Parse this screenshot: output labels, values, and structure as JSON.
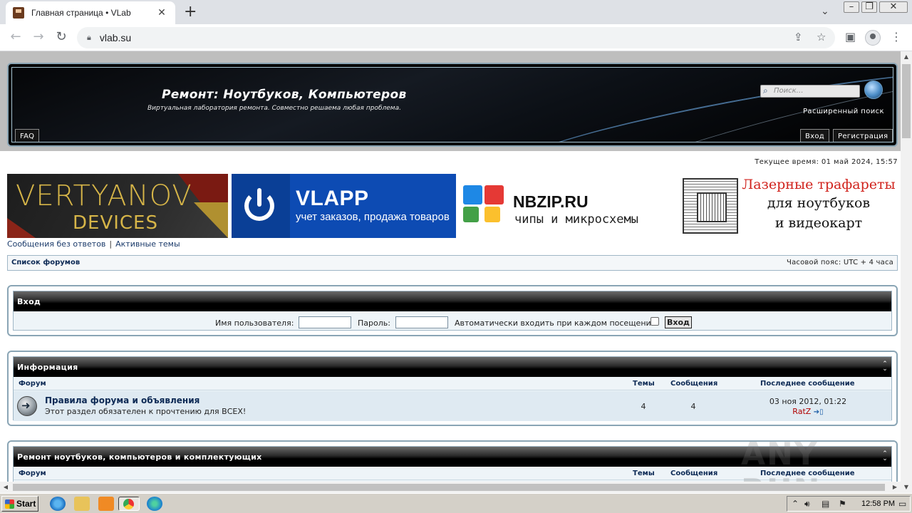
{
  "browser": {
    "tab_title": "Главная страница • VLab",
    "new_tab": "+",
    "url": "vlab.su"
  },
  "header": {
    "site_title": "Ремонт: Ноутбуков, Компьютеров",
    "site_desc": "Виртуальная лаборатория ремонта. Совместно решаема любая проблема.",
    "search_placeholder": "Поиск…",
    "adv_search": "Расширенный поиск",
    "faq": "FAQ",
    "login": "Вход",
    "register": "Регистрация"
  },
  "current_time": "Текущее время: 01 май 2024, 15:57",
  "ads": {
    "ad1": {
      "line1": "VERTYANOV",
      "line2": "DEVICES"
    },
    "ad2": {
      "name": "VLAPP",
      "sub": "учет заказов, продажа товаров"
    },
    "ad3": {
      "name": "NBZIP.RU",
      "sub": "чипы и микросхемы"
    },
    "ad4": {
      "line1": "Лазерные трафареты",
      "line2": "для ноутбуков",
      "line3": "и видеокарт"
    },
    "colors": {
      "vlapp_blue": "#0d4bb3",
      "nbzip_red": "#e53935",
      "nbzip_blue": "#1e88e5",
      "nbzip_green": "#43a047",
      "nbzip_yellow": "#fbc02d",
      "vertyanov_gold": "#d6b548"
    }
  },
  "quicklinks": {
    "unanswered": "Сообщения без ответов",
    "separator": "|",
    "active": "Активные темы"
  },
  "navbar": {
    "forum_index": "Список форумов",
    "timezone": "Часовой пояс: UTC + 4 часа"
  },
  "login_panel": {
    "title": "Вход",
    "username_label": "Имя пользователя:",
    "password_label": "Пароль:",
    "autologin_label": "Автоматически входить при каждом посещении",
    "submit": "Вход"
  },
  "info_panel": {
    "title": "Информация",
    "toggle": "⌃⌄",
    "columns": {
      "forum": "Форум",
      "topics": "Темы",
      "posts": "Сообщения",
      "last": "Последнее сообщение"
    },
    "rows": [
      {
        "name": "Правила форума и объявления",
        "desc": "Этот раздел обязателен к прочтению для ВСЕХ!",
        "topics": "4",
        "posts": "4",
        "last_date": "03 ноя 2012, 01:22",
        "last_author": "RatZ"
      }
    ]
  },
  "repair_panel": {
    "title": "Ремонт ноутбуков, компьютеров и комплектующих",
    "toggle": "⌃⌄",
    "columns": {
      "forum": "Форум",
      "topics": "Темы",
      "posts": "Сообщения",
      "last": "Последнее сообщение"
    }
  },
  "watermark": "ANY RUN",
  "taskbar": {
    "start": "Start",
    "clock": "12:58 PM"
  }
}
